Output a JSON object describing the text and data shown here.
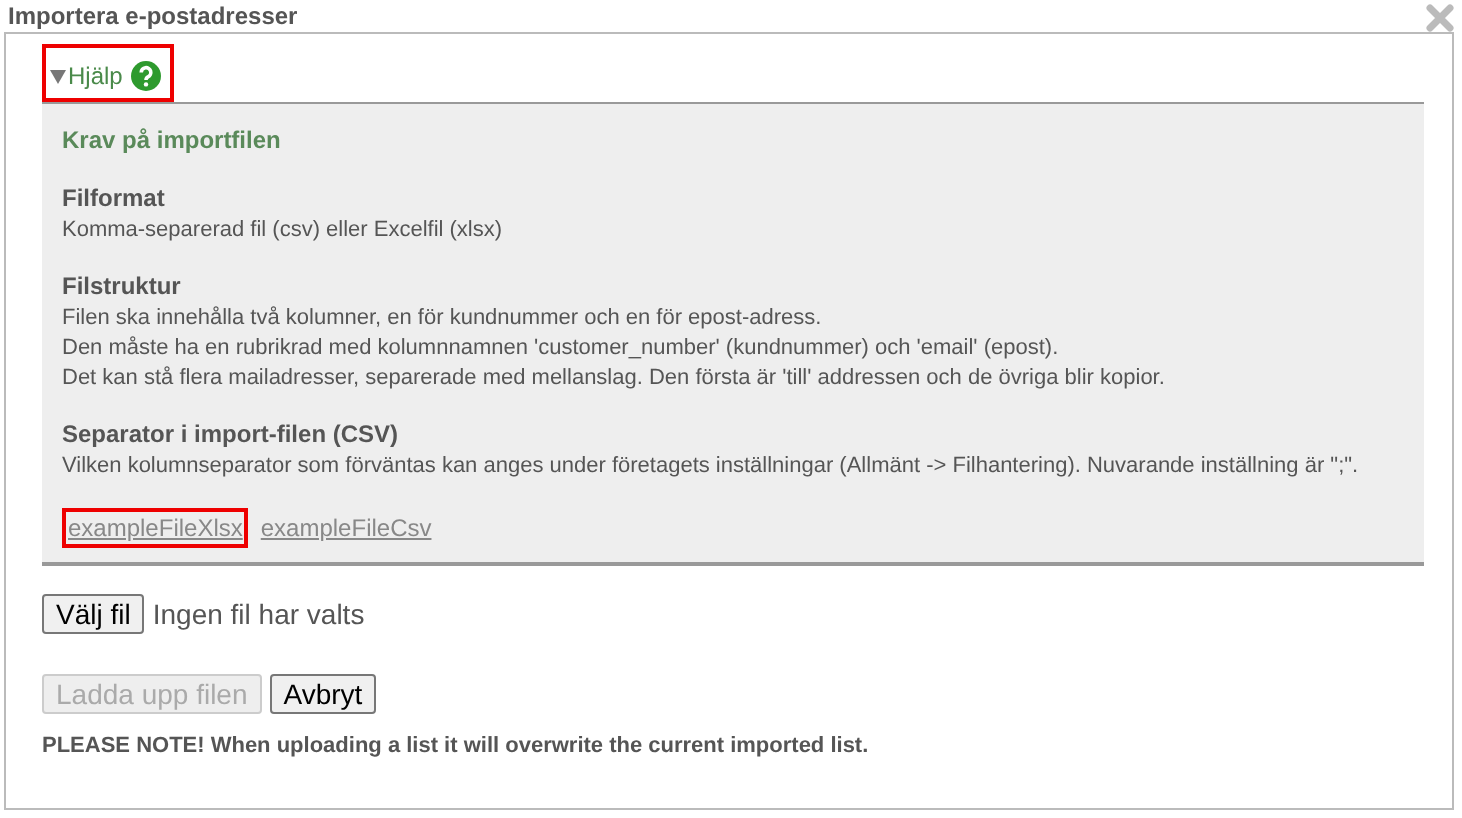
{
  "window": {
    "title": "Importera e-postadresser"
  },
  "help": {
    "label": "Hjälp",
    "expanded": true,
    "highlighted": true,
    "heading": "Krav på importfilen",
    "sections": [
      {
        "title": "Filformat",
        "lines": [
          "Komma-separerad fil (csv) eller Excelfil (xlsx)"
        ]
      },
      {
        "title": "Filstruktur",
        "lines": [
          "Filen ska innehålla två kolumner, en för kundnummer och en för epost-adress.",
          "Den måste ha en rubrikrad med kolumnnamnen 'customer_number' (kundnummer) och 'email' (epost).",
          "Det kan stå flera mailadresser, separerade med mellanslag. Den första är 'till' addressen och de övriga blir kopior."
        ]
      },
      {
        "title": "Separator i import-filen (CSV)",
        "lines": [
          "Vilken kolumnseparator som förväntas kan anges under företagets inställningar (Allmänt -> Filhantering). Nuvarande inställning är \";\"."
        ]
      }
    ],
    "links": [
      {
        "label": "exampleFileXlsx",
        "highlighted": true
      },
      {
        "label": "exampleFileCsv",
        "highlighted": false
      }
    ]
  },
  "file_picker": {
    "button": "Välj fil",
    "status": "Ingen fil har valts"
  },
  "buttons": [
    {
      "label": "Ladda upp filen",
      "disabled": true
    },
    {
      "label": "Avbryt",
      "disabled": false
    }
  ],
  "note": "PLEASE NOTE! When uploading a list it will overwrite the current imported list."
}
